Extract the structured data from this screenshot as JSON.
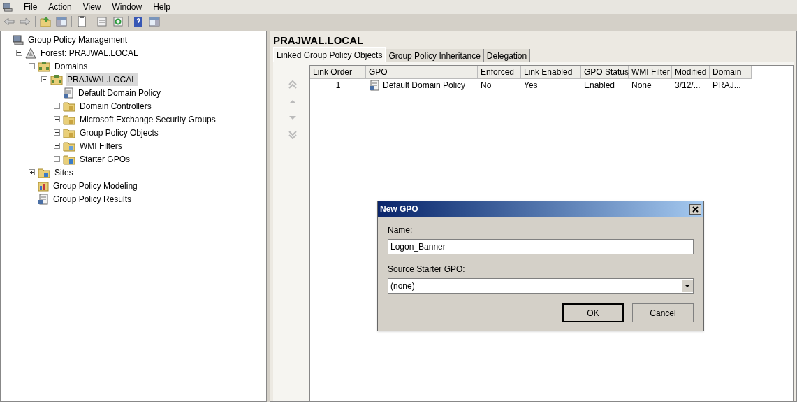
{
  "menu": [
    "File",
    "Action",
    "View",
    "Window",
    "Help"
  ],
  "tree": [
    {
      "label": "Group Policy Management",
      "kind": "console",
      "selected": false,
      "children": [
        {
          "label": "Forest: PRAJWAL.LOCAL",
          "kind": "forest",
          "expanded": true,
          "selected": false,
          "children": [
            {
              "label": "Domains",
              "kind": "domains",
              "expanded": true,
              "selected": false,
              "children": [
                {
                  "label": "PRAJWAL.LOCAL",
                  "kind": "domain",
                  "expanded": true,
                  "selected": true,
                  "children": [
                    {
                      "label": "Default Domain Policy",
                      "kind": "gpo",
                      "selected": false
                    },
                    {
                      "label": "Domain Controllers",
                      "kind": "folder",
                      "expanded": false,
                      "selected": false
                    },
                    {
                      "label": "Microsoft Exchange Security Groups",
                      "kind": "folder",
                      "expanded": false,
                      "selected": false
                    },
                    {
                      "label": "Group Policy Objects",
                      "kind": "gpofolder",
                      "expanded": false,
                      "selected": false
                    },
                    {
                      "label": "WMI Filters",
                      "kind": "filter",
                      "expanded": false,
                      "selected": false
                    },
                    {
                      "label": "Starter GPOs",
                      "kind": "starter",
                      "expanded": false,
                      "selected": false
                    }
                  ]
                }
              ]
            },
            {
              "label": "Sites",
              "kind": "sites",
              "expanded": false,
              "selected": false
            },
            {
              "label": "Group Policy Modeling",
              "kind": "modeling",
              "selected": false
            },
            {
              "label": "Group Policy Results",
              "kind": "results",
              "selected": false
            }
          ]
        }
      ]
    }
  ],
  "detail": {
    "title": "PRAJWAL.LOCAL",
    "tabs": [
      {
        "label": "Linked Group Policy Objects",
        "selected": true
      },
      {
        "label": "Group Policy Inheritance",
        "selected": false
      },
      {
        "label": "Delegation",
        "selected": false
      }
    ],
    "table": {
      "columns": [
        "Link Order",
        "GPO",
        "Enforced",
        "Link Enabled",
        "GPO Status",
        "WMI Filter",
        "Modified",
        "Domain"
      ],
      "rows": [
        [
          "1",
          "Default Domain Policy",
          "No",
          "Yes",
          "Enabled",
          "None",
          "3/12/...",
          "PRAJ..."
        ]
      ]
    }
  },
  "dialog": {
    "title": "New GPO",
    "name_label": "Name:",
    "name_value": "Logon_Banner",
    "source_label": "Source Starter GPO:",
    "source_value": "(none)",
    "buttons": [
      "OK",
      "Cancel"
    ]
  }
}
